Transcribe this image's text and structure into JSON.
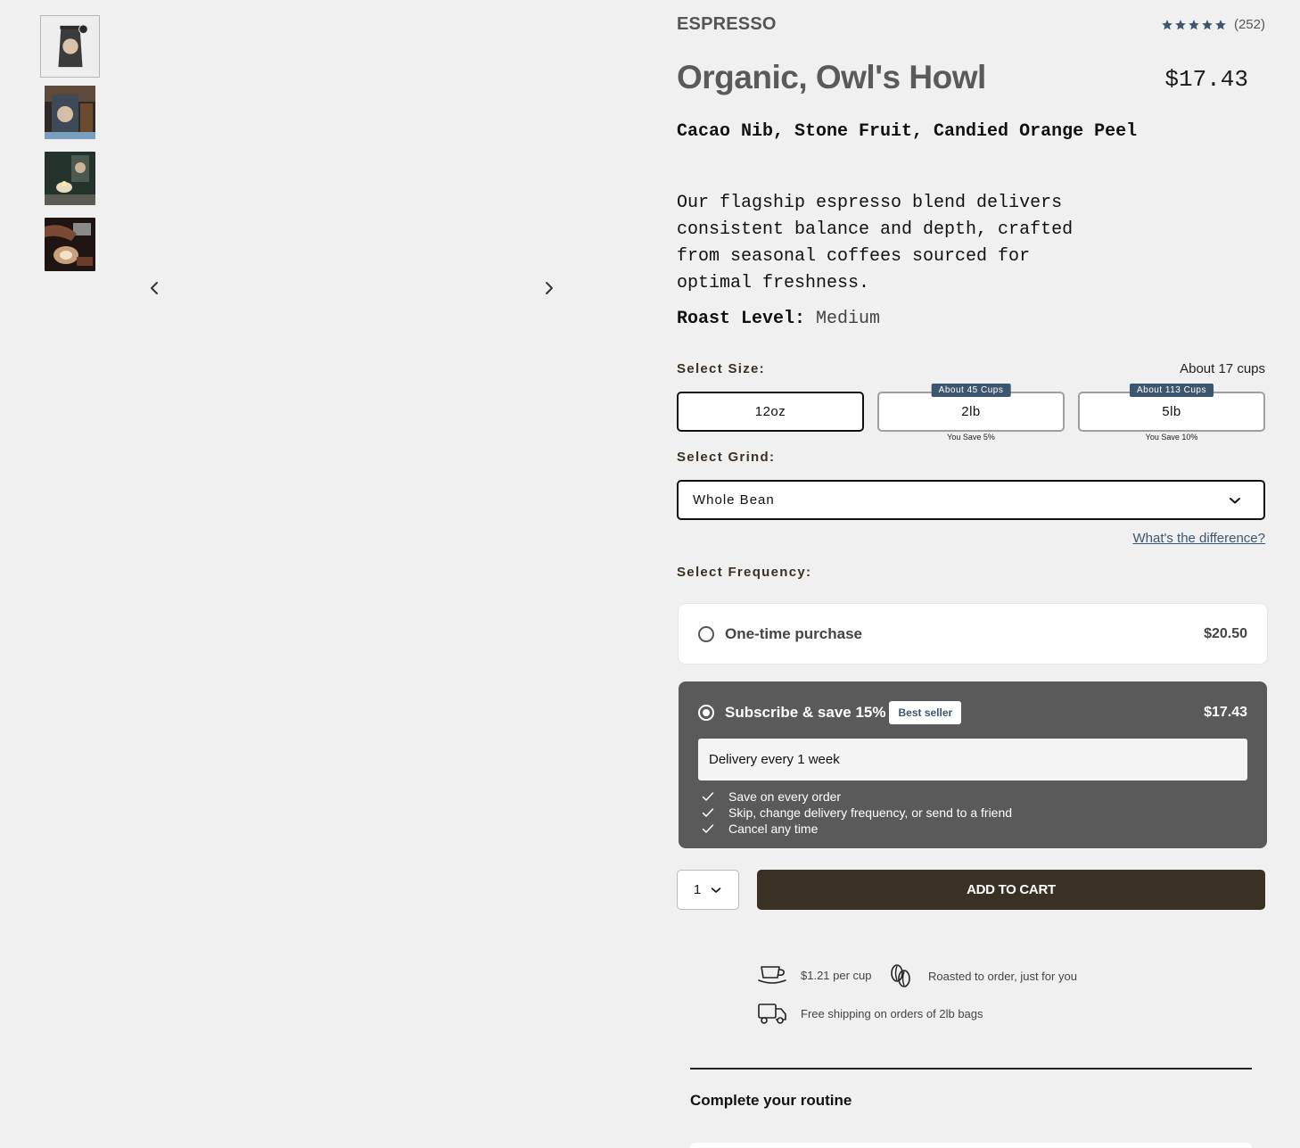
{
  "gallery": {
    "thumbnails": [
      {
        "label": "bag-front",
        "active": true
      },
      {
        "label": "bag-lifestyle",
        "active": false
      },
      {
        "label": "candle-lifestyle",
        "active": false
      },
      {
        "label": "latte-art",
        "active": false
      }
    ]
  },
  "product": {
    "category": "ESPRESSO",
    "rating_count": "(252)",
    "rating_stars": 5,
    "title": "Organic, Owl's Howl",
    "price": "$17.43",
    "tasting_notes": "Cacao Nib, Stone Fruit, Candied Orange Peel",
    "description": "Our flagship espresso blend delivers consistent balance and depth, crafted from seasonal coffees sourced for optimal freshness.",
    "roast_label": "Roast Level:",
    "roast_value": "Medium"
  },
  "size": {
    "label": "Select Size:",
    "cups_note": "About 17 cups",
    "options": [
      {
        "label": "12oz",
        "badge": "",
        "save": "",
        "selected": true
      },
      {
        "label": "2lb",
        "badge": "About 45 Cups",
        "save": "You Save 5%",
        "selected": false
      },
      {
        "label": "5lb",
        "badge": "About 113 Cups",
        "save": "You Save 10%",
        "selected": false
      }
    ]
  },
  "grind": {
    "label": "Select Grind:",
    "value": "Whole Bean",
    "help_link": "What's the difference?"
  },
  "frequency": {
    "label": "Select Frequency:",
    "one_time": {
      "name": "One-time purchase",
      "price": "$20.50"
    },
    "subscribe": {
      "name": "Subscribe & save 15%",
      "badge": "Best seller",
      "price": "$17.43",
      "delivery": "Delivery every 1 week",
      "perks": [
        "Save on every order",
        "Skip, change delivery frequency, or send to a friend",
        "Cancel any time"
      ]
    }
  },
  "cart": {
    "quantity": "1",
    "add_label": "ADD TO CART"
  },
  "features": {
    "per_cup": "$1.21 per cup",
    "roasted": "Roasted to order, just for you",
    "shipping": "Free shipping on orders of 2lb bags"
  },
  "routine": {
    "title": "Complete your routine"
  },
  "colors": {
    "accent_blue": "#3d5670",
    "cart_brown": "#3b3024",
    "subscribe_bg": "#5a5a5a"
  }
}
